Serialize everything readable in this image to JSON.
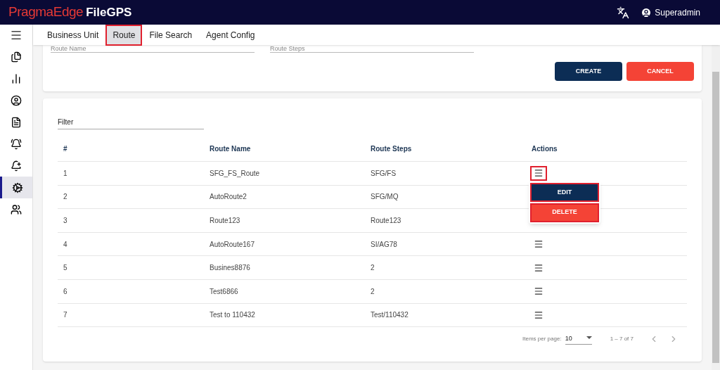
{
  "header": {
    "brand": "PragmaEdge",
    "product": "FileGPS",
    "user": "Superadmin"
  },
  "sidebar": {
    "items": [
      {
        "selected": false
      },
      {
        "selected": false
      },
      {
        "selected": false
      },
      {
        "selected": false
      },
      {
        "selected": false
      },
      {
        "selected": false
      },
      {
        "selected": true
      },
      {
        "selected": false
      }
    ]
  },
  "tabs": [
    {
      "label": "Business Unit",
      "selected": false
    },
    {
      "label": "Route",
      "selected": true
    },
    {
      "label": "File Search",
      "selected": false
    },
    {
      "label": "Agent Config",
      "selected": false
    }
  ],
  "form": {
    "fields": [
      {
        "placeholder": "Route Name"
      },
      {
        "placeholder": "Route Steps"
      }
    ],
    "buttons": [
      {
        "label": "CREATE",
        "kind": "primary"
      },
      {
        "label": "CANCEL",
        "kind": "danger"
      }
    ]
  },
  "filter": {
    "placeholder": "Filter"
  },
  "table": {
    "columns": [
      "#",
      "Route Name",
      "Route Steps",
      "Actions"
    ],
    "rows": [
      {
        "cells": [
          "1",
          "SFG_FS_Route",
          "SFG/FS"
        ],
        "menu_open": true
      },
      {
        "cells": [
          "2",
          "AutoRoute2",
          "SFG/MQ"
        ],
        "menu_open": false
      },
      {
        "cells": [
          "3",
          "Route123",
          "Route123"
        ],
        "menu_open": false
      },
      {
        "cells": [
          "4",
          "AutoRoute167",
          "SI/AG78"
        ],
        "menu_open": false
      },
      {
        "cells": [
          "5",
          "Busines8876",
          "2"
        ],
        "menu_open": false
      },
      {
        "cells": [
          "6",
          "Test6866",
          "2"
        ],
        "menu_open": false
      },
      {
        "cells": [
          "7",
          "Test to 110432",
          "Test/110432"
        ],
        "menu_open": false
      }
    ]
  },
  "action_menu": [
    {
      "label": "EDIT",
      "kind": "primary"
    },
    {
      "label": "DELETE",
      "kind": "danger"
    }
  ],
  "paginator": {
    "label": "Items per page:",
    "page_size": "10",
    "range": "1 – 7 of 7"
  }
}
